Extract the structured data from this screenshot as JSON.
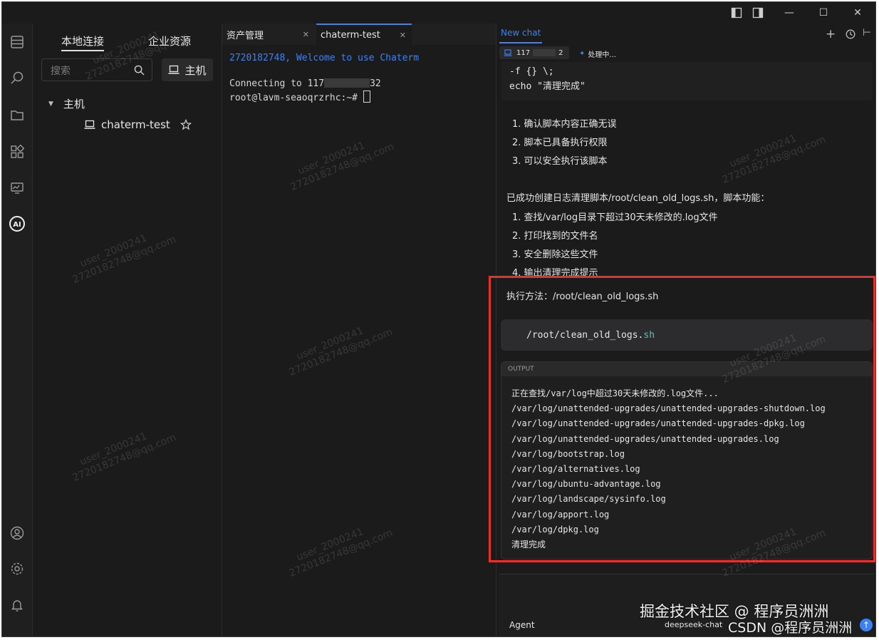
{
  "window": {
    "layout_toggle_left_icon": "panel-left-icon",
    "layout_toggle_right_icon": "panel-right-icon",
    "minimize": "—",
    "maximize": "☐",
    "close": "✕"
  },
  "activity_bar": [
    "files-icon",
    "search-icon",
    "folder-icon",
    "apps-icon",
    "monitor-icon",
    "ai-icon",
    "user-icon",
    "gear-icon",
    "bell-icon"
  ],
  "sidebar": {
    "tabs": [
      "本地连接",
      "企业资源"
    ],
    "search_placeholder": "搜索",
    "host_button": "主机",
    "tree_root": "主机",
    "tree_item": "chaterm-test"
  },
  "terminal": {
    "tabs": [
      {
        "label": "资产管理"
      },
      {
        "label": "chaterm-test"
      }
    ],
    "welcome": "2720182748, Welcome to use Chaterm",
    "connecting": "Connecting to 117",
    "connecting_tail": "32",
    "prompt": "root@lavm-seaoqrzrhc:~# "
  },
  "chat": {
    "tab_label": "New chat",
    "host_chip": "117",
    "host_chip_tail": "2",
    "status_chip": "处理中...",
    "code_top_line1": "-f {} \\;",
    "code_top_line2": "echo \"清理完成\"",
    "checklist": [
      "1. 确认脚本内容正确无误",
      "2. 脚本已具备执行权限",
      "3. 可以安全执行该脚本"
    ],
    "summary": "已成功创建日志清理脚本/root/clean_old_logs.sh，脚本功能：",
    "features": [
      "1. 查找/var/log目录下超过30天未修改的.log文件",
      "2. 打印找到的文件名",
      "3. 安全删除这些文件",
      "4. 输出清理完成提示"
    ],
    "exec_method": "执行方法：/root/clean_old_logs.sh",
    "command_path": "/root/clean_old_logs.",
    "command_ext": "sh",
    "output_label": "OUTPUT",
    "output_lines": [
      "正在查找/var/log中超过30天未修改的.log文件...",
      "/var/log/unattended-upgrades/unattended-upgrades-shutdown.log",
      "/var/log/unattended-upgrades/unattended-upgrades-dpkg.log",
      "/var/log/unattended-upgrades/unattended-upgrades.log",
      "/var/log/bootstrap.log",
      "/var/log/alternatives.log",
      "/var/log/ubuntu-advantage.log",
      "/var/log/landscape/sysinfo.log",
      "/var/log/apport.log",
      "/var/log/dpkg.log",
      "清理完成"
    ],
    "mode": "Agent",
    "model": "deepseek-chat"
  },
  "watermark": {
    "line1": "user_2000241",
    "line2": "2720182748@qq.com"
  },
  "overlay": {
    "brand1": "掘金技术社区 @ 程序员洲洲",
    "brand2": "CSDN @程序员洲洲"
  },
  "colors": {
    "accent": "#3b82f6",
    "highlight_box": "#e8312a",
    "terminal_welcome": "#3b82f6"
  }
}
